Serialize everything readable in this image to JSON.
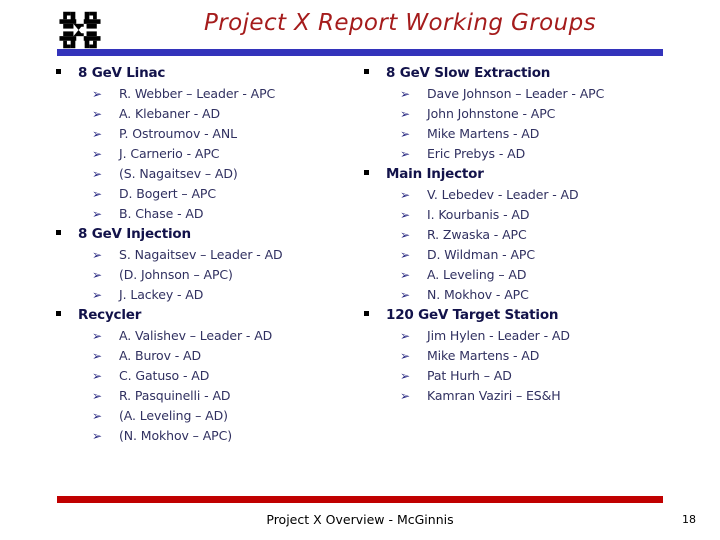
{
  "slide": {
    "title": "Project X Report Working Groups",
    "logo_icon": "fermilab-logo-icon",
    "accent_blue": "#3333BB",
    "accent_red": "#C00000",
    "title_color": "#A51C1C",
    "body_color": "#303060"
  },
  "bullets": {
    "group_marker": "square-bullet-icon",
    "member_marker": "➢"
  },
  "columns": {
    "left": [
      {
        "heading": "8 GeV Linac",
        "members": [
          "R. Webber – Leader - APC",
          "A. Klebaner - AD",
          "P. Ostroumov - ANL",
          "J. Carnerio - APC",
          "(S. Nagaitsev – AD)",
          "D. Bogert – APC",
          "B. Chase - AD"
        ]
      },
      {
        "heading": "8 GeV Injection",
        "members": [
          "S. Nagaitsev – Leader - AD",
          "(D. Johnson – APC)",
          "J. Lackey - AD"
        ]
      },
      {
        "heading": "Recycler",
        "members": [
          "A. Valishev – Leader - AD",
          "A. Burov - AD",
          "C. Gatuso - AD",
          "R. Pasquinelli - AD",
          "(A. Leveling – AD)",
          "(N. Mokhov – APC)"
        ]
      }
    ],
    "right": [
      {
        "heading": "8 GeV Slow Extraction",
        "members": [
          "Dave Johnson – Leader - APC",
          "John Johnstone - APC",
          "Mike Martens - AD",
          "Eric Prebys - AD"
        ]
      },
      {
        "heading": "Main Injector",
        "members": [
          "V. Lebedev  - Leader - AD",
          "I. Kourbanis - AD",
          "R. Zwaska - APC",
          "D. Wildman - APC",
          "A. Leveling – AD",
          "N. Mokhov - APC"
        ]
      },
      {
        "heading": "120 GeV Target Station",
        "members": [
          "Jim Hylen  - Leader - AD",
          "Mike Martens - AD",
          "Pat Hurh – AD",
          "Kamran Vaziri – ES&H"
        ]
      }
    ]
  },
  "footer": {
    "text": "Project X Overview - McGinnis",
    "page_number": "18"
  }
}
